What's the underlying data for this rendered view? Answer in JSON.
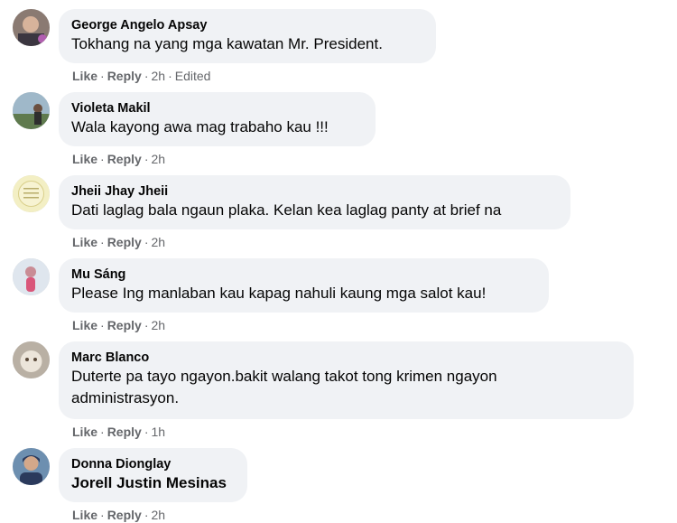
{
  "comments": [
    {
      "author": "George Angelo Apsay",
      "text": "Tokhang na yang mga kawatan Mr. President.",
      "like": "Like",
      "reply": "Reply",
      "time": "2h",
      "edited": "Edited"
    },
    {
      "author": "Violeta Makil",
      "text": "Wala kayong awa mag trabaho kau !!!",
      "like": "Like",
      "reply": "Reply",
      "time": "2h"
    },
    {
      "author": "Jheii Jhay Jheii",
      "text": "Dati laglag bala ngaun plaka. Kelan kea laglag panty at brief na",
      "like": "Like",
      "reply": "Reply",
      "time": "2h"
    },
    {
      "author": "Mu Sáng",
      "text": "Please Ing manlaban kau kapag nahuli kaung mga salot kau!",
      "like": "Like",
      "reply": "Reply",
      "time": "2h"
    },
    {
      "author": "Marc Blanco",
      "text_line1": "Duterte pa tayo ngayon.bakit walang takot tong krimen ngayon",
      "text_line2": "administrasyon.",
      "like": "Like",
      "reply": "Reply",
      "time": "1h"
    },
    {
      "author": "Donna Dionglay",
      "text": "Jorell Justin Mesinas",
      "like": "Like",
      "reply": "Reply",
      "time": "2h"
    }
  ],
  "separator": "·"
}
